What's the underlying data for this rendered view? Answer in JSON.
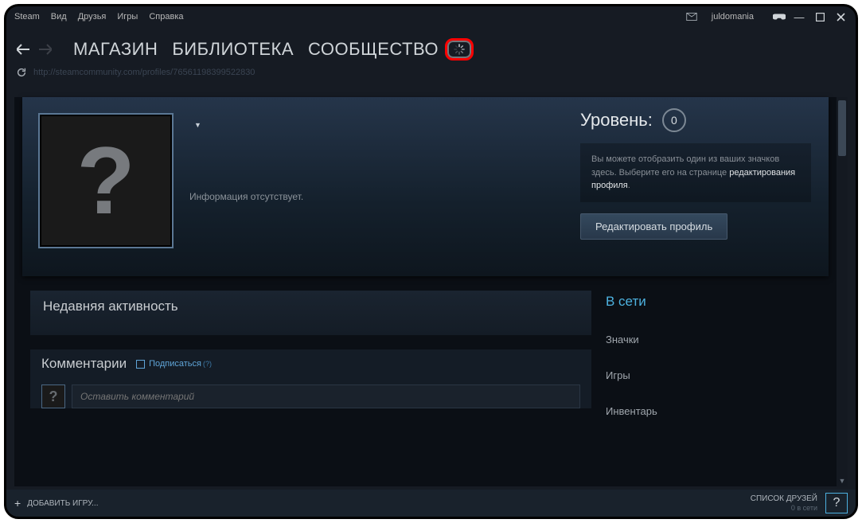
{
  "menubar": {
    "items": [
      "Steam",
      "Вид",
      "Друзья",
      "Игры",
      "Справка"
    ],
    "username": "juldomania"
  },
  "nav": {
    "items": [
      "МАГАЗИН",
      "БИБЛИОТЕКА",
      "СООБЩЕСТВО"
    ]
  },
  "url": "http://steamcommunity.com/profiles/76561198399522830",
  "profile": {
    "avatar_glyph": "?",
    "no_info": "Информация отсутствует.",
    "level_label": "Уровень:",
    "level_value": "0",
    "badge_hint_1": "Вы можете отобразить один из ваших значков здесь. Выберите его на странице ",
    "badge_hint_link": "редактирования профиля",
    "badge_hint_2": ".",
    "edit_button": "Редактировать профиль"
  },
  "activity": {
    "title": "Недавняя активность"
  },
  "comments": {
    "title": "Комментарии",
    "subscribe": "Подписаться",
    "sup": "(?)",
    "placeholder": "Оставить комментарий"
  },
  "sidebar": {
    "online": "В сети",
    "links": [
      "Значки",
      "Игры",
      "Инвентарь"
    ]
  },
  "bottombar": {
    "add_game": "ДОБАВИТЬ ИГРУ...",
    "friends_label": "СПИСОК ДРУЗЕЙ",
    "friends_sub": "0 в сети",
    "help": "?"
  }
}
